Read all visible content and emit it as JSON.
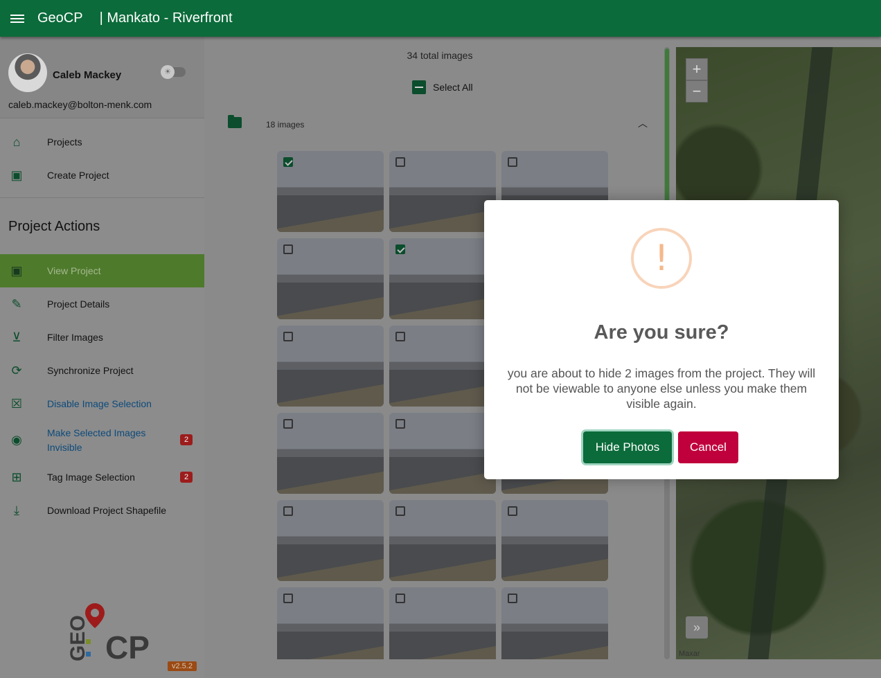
{
  "header": {
    "app_name": "GeoCP",
    "project_title": "| Mankato - Riverfront"
  },
  "user": {
    "name": "Caleb Mackey",
    "email": "caleb.mackey@bolton-menk.com"
  },
  "nav": {
    "projects": "Projects",
    "create_project": "Create Project",
    "section_title": "Project Actions",
    "view_project": "View Project",
    "project_details": "Project Details",
    "filter_images": "Filter Images",
    "synchronize_project": "Synchronize Project",
    "disable_image_selection": "Disable Image Selection",
    "make_invisible_line1": "Make Selected Images",
    "make_invisible_line2": "Invisible",
    "make_invisible_badge": "2",
    "tag_image_selection": "Tag Image Selection",
    "tag_badge": "2",
    "download_shapefile": "Download Project Shapefile"
  },
  "version": "v2.5.2",
  "gallery": {
    "total": "34 total images",
    "select_all": "Select All",
    "group_count": "18 images",
    "thumbs_checked": [
      true,
      false,
      false,
      false,
      true,
      false,
      false,
      false,
      false,
      false,
      false,
      false,
      false,
      false,
      false,
      false,
      false,
      false
    ]
  },
  "map": {
    "zoom_in": "+",
    "zoom_out": "−",
    "attribution": "Maxar",
    "expand": "»"
  },
  "dialog": {
    "icon": "!",
    "title": "Are you sure?",
    "message": "you are about to hide 2 images from the project. They will not be viewable to anyone else unless you make them visible again.",
    "confirm": "Hide Photos",
    "cancel": "Cancel"
  }
}
